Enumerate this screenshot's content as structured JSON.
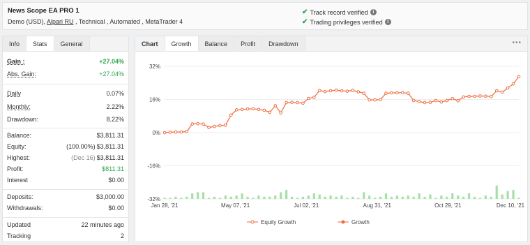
{
  "header": {
    "title": "News Scope EA PRO 1",
    "sub_prefix": "Demo (USD), ",
    "broker": "Alpari RU",
    "sub_suffix": " , Technical , Automated , MetaTrader 4",
    "verify1": "Track record verified",
    "verify2": "Trading privileges verified"
  },
  "left_tabs": [
    "Info",
    "Stats",
    "General"
  ],
  "stats": {
    "gain_label": "Gain :",
    "gain": "+27.04%",
    "abs_label": "Abs. Gain:",
    "abs": "+27.04%",
    "daily_label": "Daily",
    "daily": "0.07%",
    "monthly_label": "Monthly:",
    "monthly": "2.22%",
    "drawdown_label": "Drawdown:",
    "drawdown": "8.22%",
    "balance_label": "Balance:",
    "balance": "$3,811.31",
    "equity_label": "Equity:",
    "equity_pct": "(100.00%)",
    "equity": "$3,811.31",
    "highest_label": "Highest:",
    "highest_date": "(Dec 16)",
    "highest": "$3,811.31",
    "profit_label": "Profit:",
    "profit": "$811.31",
    "interest_label": "Interest",
    "interest": "$0.00",
    "deposits_label": "Deposits:",
    "deposits": "$3,000.00",
    "withdrawals_label": "Withdrawals:",
    "withdrawals": "$0.00",
    "updated_label": "Updated",
    "updated": "22 minutes ago",
    "tracking_label": "Tracking",
    "tracking": "2"
  },
  "right_tabs": [
    "Chart",
    "Growth",
    "Balance",
    "Profit",
    "Drawdown"
  ],
  "more": "•••",
  "colors": {
    "growth": "#ef6c3e",
    "bars": "#a7e0a7",
    "check": "#2fa84f"
  },
  "chart_data": {
    "type": "line",
    "y_ticks": [
      "32%",
      "16%",
      "0%",
      "-16%",
      "-32%"
    ],
    "ylim": [
      -32,
      32
    ],
    "x_ticks": [
      "Jan 28, '21",
      "May 07, '21",
      "Jul 02, '21",
      "Aug 31, '21",
      "Oct 29, '21",
      "Dec 10, '21"
    ],
    "legend": [
      "Equity Growth",
      "Growth"
    ],
    "series": [
      {
        "name": "Growth",
        "values": [
          0,
          0.2,
          0.3,
          0.3,
          0.5,
          4.2,
          4.3,
          4.1,
          2.5,
          3.0,
          3.4,
          3.6,
          8.5,
          11,
          11.2,
          11.4,
          11.5,
          11.2,
          10.8,
          9.8,
          13,
          9.5,
          14.5,
          14.6,
          14.5,
          14.2,
          16.5,
          17,
          20.3,
          19.8,
          20.2,
          20.5,
          20.2,
          20.0,
          20.4,
          19.7,
          19.0,
          15.8,
          15.8,
          15.9,
          19.0,
          19.2,
          19.2,
          19.3,
          19.0,
          15.5,
          15.0,
          14.5,
          14.6,
          15.5,
          14.8,
          15.5,
          16.4,
          15.4,
          17.2,
          17.5,
          17.5,
          17.7,
          17.6,
          17.4,
          20.2,
          19.5,
          21.5,
          23.5,
          27.04
        ]
      },
      {
        "name": "Bars",
        "values": [
          1,
          1,
          2,
          1,
          2,
          5,
          6,
          6,
          1,
          2,
          1,
          3,
          2,
          3,
          5,
          2,
          1,
          3,
          2,
          2,
          3,
          6,
          8,
          2,
          1,
          2,
          3,
          5,
          4,
          2,
          3,
          2,
          3,
          1,
          2,
          1,
          6,
          3,
          1,
          2,
          5,
          2,
          3,
          2,
          3,
          2,
          5,
          2,
          4,
          1,
          3,
          2,
          5,
          3,
          2,
          5,
          2,
          1,
          3,
          2,
          12,
          4,
          7,
          8,
          1
        ]
      }
    ]
  }
}
